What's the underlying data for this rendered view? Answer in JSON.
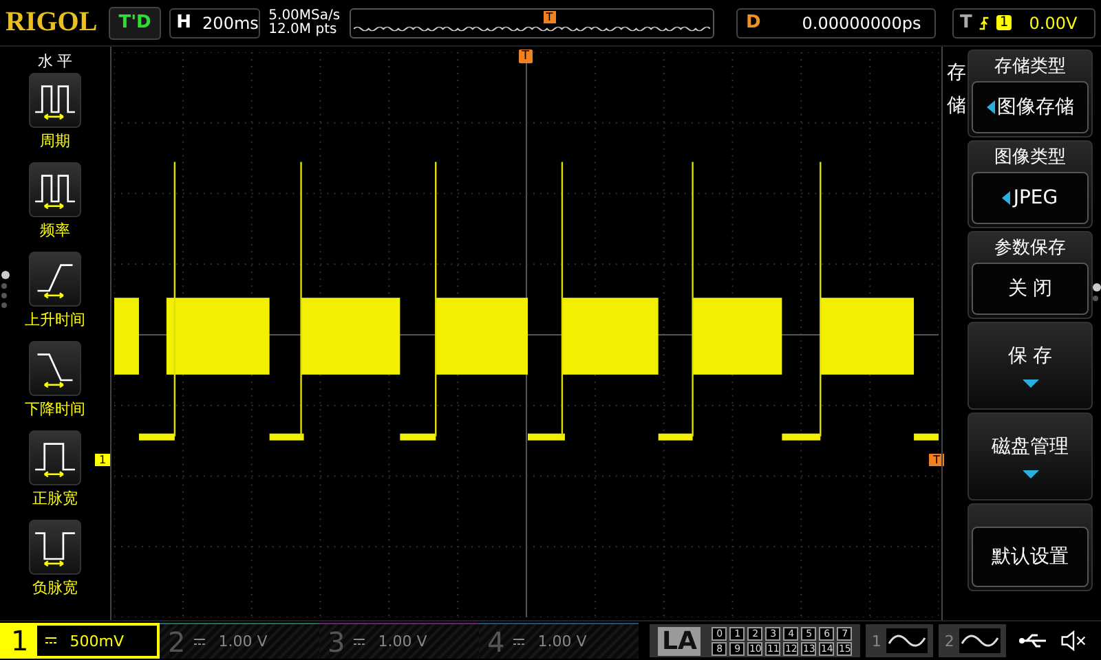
{
  "top_bar": {
    "logo": "RIGOL",
    "run_status": "T'D",
    "horizontal": {
      "label": "H",
      "timebase": "200ms"
    },
    "sample_rate": "5.00MSa/s",
    "memory_depth": "12.0M pts",
    "overview_trigger": "T",
    "delay": {
      "label": "D",
      "value": "0.00000000ps"
    },
    "trigger": {
      "label": "T",
      "source": "1",
      "level": "0.00V"
    }
  },
  "left_menu": {
    "title": "水 平",
    "pages": [
      {
        "selected": true
      },
      {
        "selected": false
      },
      {
        "selected": false
      },
      {
        "selected": false
      }
    ],
    "items": [
      {
        "kind": "period",
        "label": "周期"
      },
      {
        "kind": "frequency",
        "label": "频率"
      },
      {
        "kind": "rise",
        "label": "上升时间"
      },
      {
        "kind": "fall",
        "label": "下降时间"
      },
      {
        "kind": "pos_width",
        "label": "正脉宽"
      },
      {
        "kind": "neg_width",
        "label": "负脉宽"
      }
    ]
  },
  "screen": {
    "trigger_marker": "T",
    "channel_marker": "1",
    "level_marker": "T"
  },
  "right_menu": {
    "title": "存储",
    "pages": [
      {
        "selected": true
      },
      {
        "selected": false
      }
    ],
    "items": [
      {
        "kind": "select",
        "header": "存储类型",
        "value": "图像存储",
        "arrow": true
      },
      {
        "kind": "select",
        "header": "图像类型",
        "value": "JPEG",
        "arrow": true
      },
      {
        "kind": "select",
        "header": "参数保存",
        "value": "关 闭",
        "arrow": false
      },
      {
        "kind": "submenu",
        "label": "保 存"
      },
      {
        "kind": "submenu",
        "label": "磁盘管理"
      },
      {
        "kind": "button",
        "label": "默认设置"
      }
    ]
  },
  "bottom_bar": {
    "channels": [
      {
        "number": "1",
        "scale": "500mV",
        "selected": true,
        "color": "#ffff00"
      },
      {
        "number": "2",
        "scale": "1.00 V",
        "selected": false,
        "color": "#1f6f5f"
      },
      {
        "number": "3",
        "scale": "1.00 V",
        "selected": false,
        "color": "#6f1f6f"
      },
      {
        "number": "4",
        "scale": "1.00 V",
        "selected": false,
        "color": "#1f4f7f"
      }
    ],
    "la": {
      "label": "LA",
      "bits": [
        "0",
        "1",
        "2",
        "3",
        "4",
        "5",
        "6",
        "7",
        "8",
        "9",
        "10",
        "11",
        "12",
        "13",
        "14",
        "15"
      ]
    },
    "generators": [
      {
        "number": "1"
      },
      {
        "number": "2"
      }
    ]
  }
}
